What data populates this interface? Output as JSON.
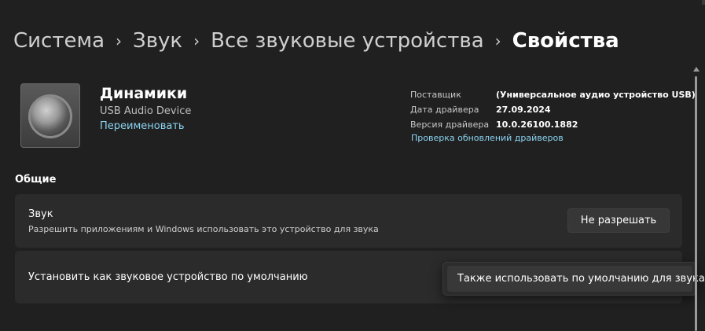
{
  "breadcrumb": {
    "items": [
      "Система",
      "Звук",
      "Все звуковые устройства"
    ],
    "current": "Свойства",
    "separator": "›"
  },
  "device": {
    "name": "Динамики",
    "subtitle": "USB Audio Device",
    "rename_link": "Переименовать",
    "icon": "speaker-icon"
  },
  "driver_info": {
    "rows": [
      {
        "label": "Поставщик",
        "value": "(Универсальное аудио устройство USB)"
      },
      {
        "label": "Дата драйвера",
        "value": "27.09.2024"
      },
      {
        "label": "Версия драйвера",
        "value": "10.0.26100.1882"
      }
    ],
    "update_link": "Проверка обновлений драйверов"
  },
  "section": {
    "title": "Общие"
  },
  "audio_card": {
    "title": "Звук",
    "description": "Разрешить приложениям и Windows использовать это устройство для звука",
    "button_label": "Не разрешать"
  },
  "default_card": {
    "title": "Установить как звуковое устройство по умолчанию"
  },
  "popup": {
    "item_label": "Также использовать по умолчанию для звука"
  },
  "colors": {
    "background": "#202020",
    "card": "#2b2b2b",
    "link": "#8ad3f0"
  }
}
